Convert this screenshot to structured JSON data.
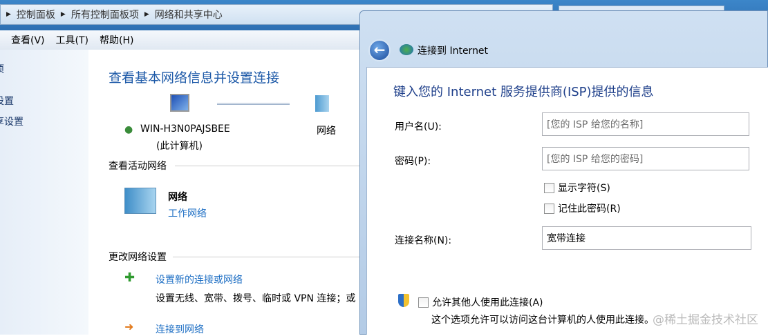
{
  "explorer": {
    "breadcrumb": [
      "控制面板",
      "所有控制面板项",
      "网络和共享中心"
    ],
    "menu": [
      "查看(V)",
      "工具(T)",
      "帮助(H)"
    ],
    "sidebar": [
      "项",
      "设置",
      "享设置"
    ],
    "title": "查看基本网络信息并设置连接",
    "computer_name": "WIN-H3N0PAJSBEE",
    "computer_note": "(此计算机)",
    "network_node": "网络",
    "active_header": "查看活动网络",
    "active_name": "网络",
    "active_type": "工作网络",
    "change_header": "更改网络设置",
    "task1_link": "设置新的连接或网络",
    "task1_desc": "设置无线、宽带、拨号、临时或 VPN 连接；或",
    "task2_link": "连接到网络"
  },
  "dialog": {
    "title": "连接到 Internet",
    "heading": "键入您的 Internet 服务提供商(ISP)提供的信息",
    "username_label": "用户名(U):",
    "username_placeholder": "[您的 ISP 给您的名称]",
    "password_label": "密码(P):",
    "password_placeholder": "[您的 ISP 给您的密码]",
    "show_chars": "显示字符(S)",
    "remember_pw": "记住此密码(R)",
    "conn_name_label": "连接名称(N):",
    "conn_name_value": "宽带连接",
    "allow_others": "允许其他人使用此连接(A)",
    "allow_desc": "这个选项允许可以访问这台计算机的人使用此连接。"
  },
  "watermark": "@稀土掘金技术社区"
}
